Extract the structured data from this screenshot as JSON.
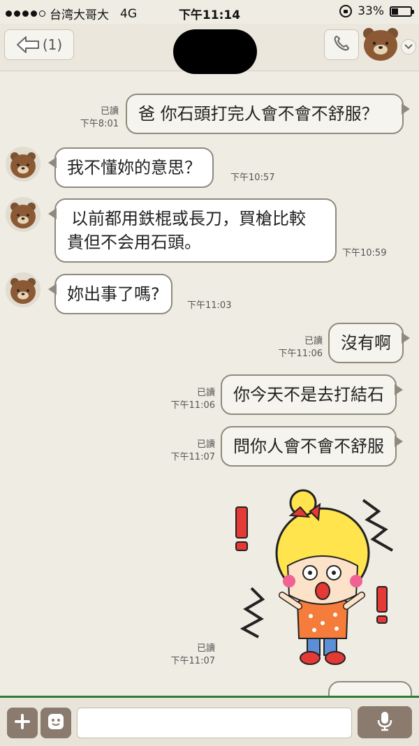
{
  "status_bar": {
    "carrier": "台湾大哥大",
    "network": "4G",
    "time": "下午11:14",
    "battery": "33%",
    "battery_level": 0.33
  },
  "header": {
    "back_label": "(1)"
  },
  "messages": [
    {
      "direction": "outgoing",
      "text": "爸 你石頭打完人會不會不舒服？",
      "read": "已讀",
      "time": "下午8:01"
    },
    {
      "direction": "incoming",
      "text": "我不懂妳的意思？",
      "time": "下午10:57"
    },
    {
      "direction": "incoming",
      "lines": [
        "以前都用鉄棍或長刀，買槍比較",
        "貴但不会用石頭。"
      ],
      "time": "下午10:59"
    },
    {
      "direction": "incoming",
      "text": "妳出事了嗎?",
      "time": "下午11:03"
    },
    {
      "direction": "outgoing",
      "text": "沒有啊",
      "read": "已讀",
      "time": "下午11:06"
    },
    {
      "direction": "outgoing",
      "text": "你今天不是去打結石",
      "read": "已讀",
      "time": "下午11:06"
    },
    {
      "direction": "outgoing",
      "text": "問你人會不會不舒服",
      "read": "已讀",
      "time": "下午11:07"
    },
    {
      "direction": "outgoing",
      "type": "sticker",
      "sticker": "shocked-girl-sticker",
      "read": "已讀",
      "time": "下午11:07"
    }
  ],
  "colors": {
    "background": "#efece3",
    "bubble_border": "#8f8a7d",
    "input_accent": "#2e7d32",
    "button_brown": "#8a7b6e"
  }
}
